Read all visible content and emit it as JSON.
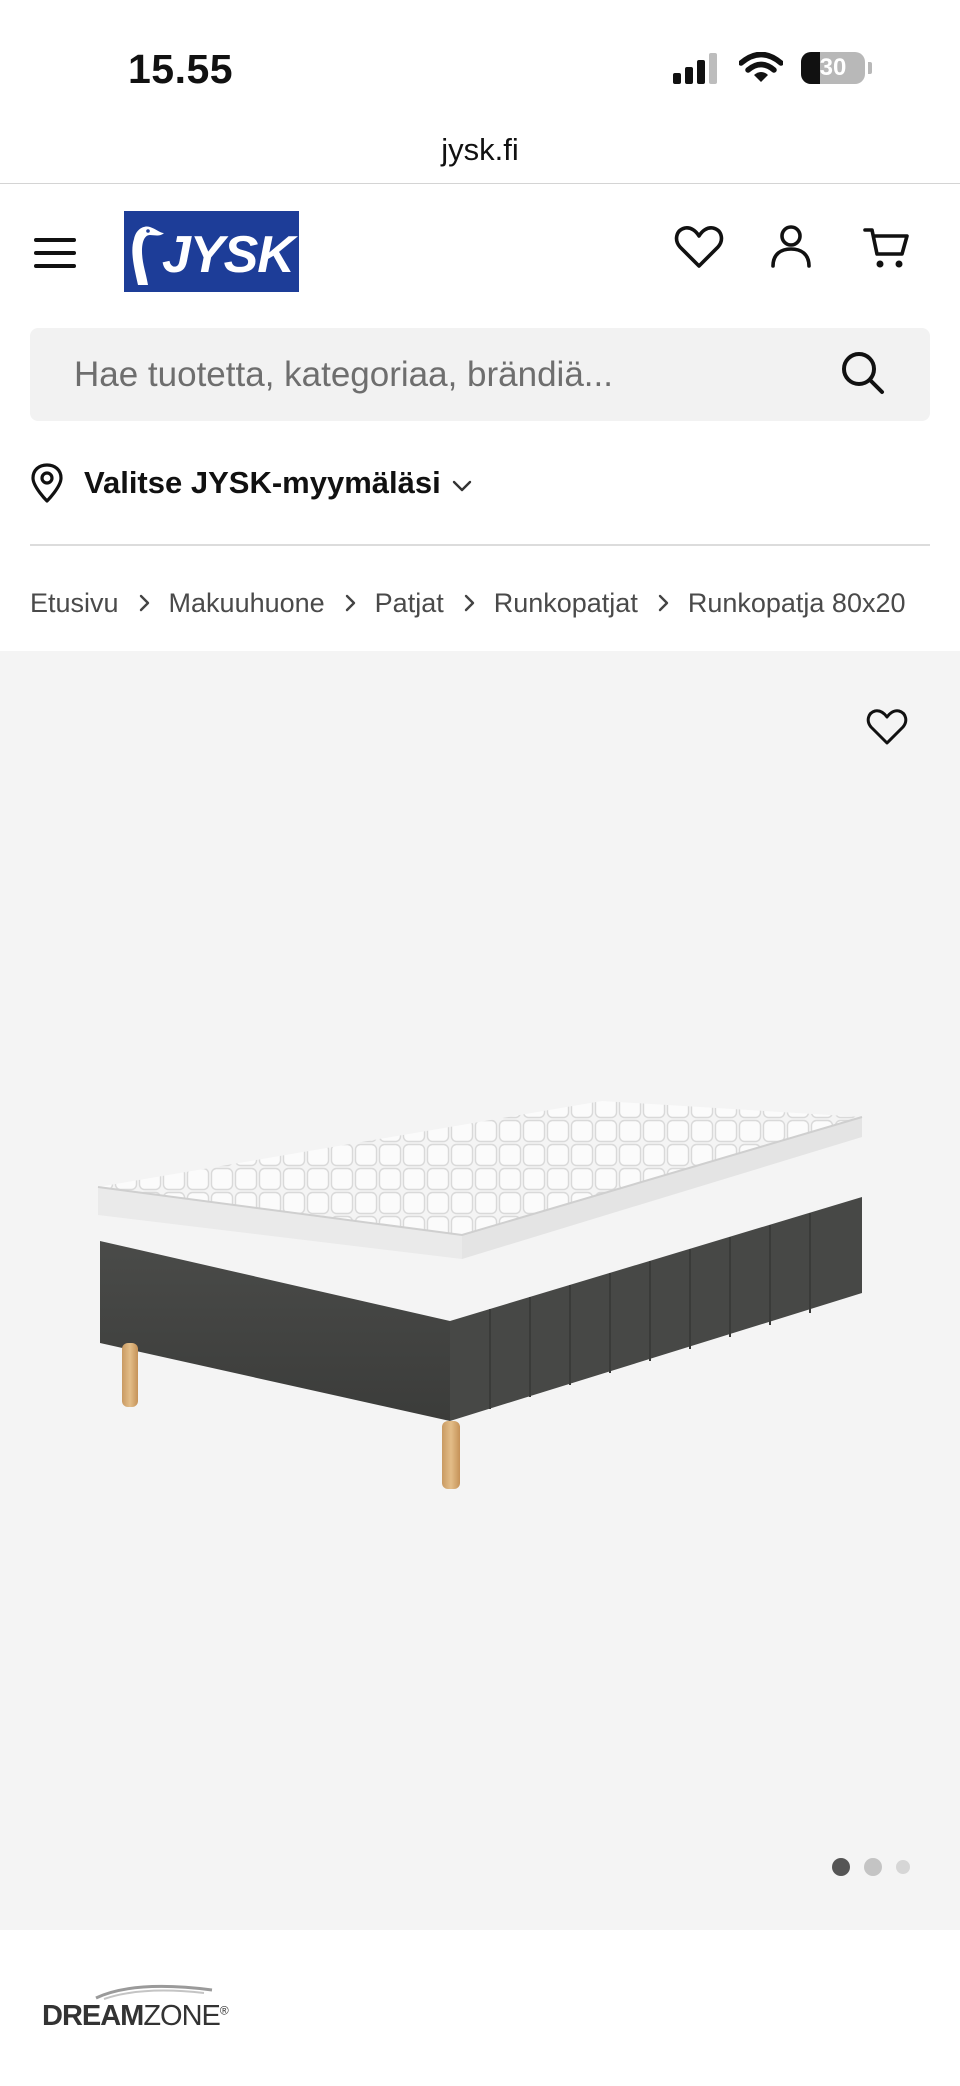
{
  "status_bar": {
    "time": "15.55",
    "battery_level": "30"
  },
  "browser": {
    "url": "jysk.fi"
  },
  "header": {
    "logo_text": "JYSK"
  },
  "search": {
    "placeholder": "Hae tuotetta, kategoriaa, brändiä..."
  },
  "store_selector": {
    "label": "Valitse JYSK-myymäläsi"
  },
  "breadcrumb": [
    {
      "label": "Etusivu"
    },
    {
      "label": "Makuuhuone"
    },
    {
      "label": "Patjat"
    },
    {
      "label": "Runkopatjat"
    },
    {
      "label": "Runkopatja 80x20"
    }
  ],
  "gallery": {
    "image_count": 3,
    "active_index": 0
  },
  "brand": {
    "name_light": "DREAM",
    "name_bold": "ZONE",
    "mark": "®"
  },
  "colors": {
    "brand_blue": "#1d3d98",
    "gallery_bg": "#f4f4f4",
    "search_bg": "#f2f2f2"
  }
}
